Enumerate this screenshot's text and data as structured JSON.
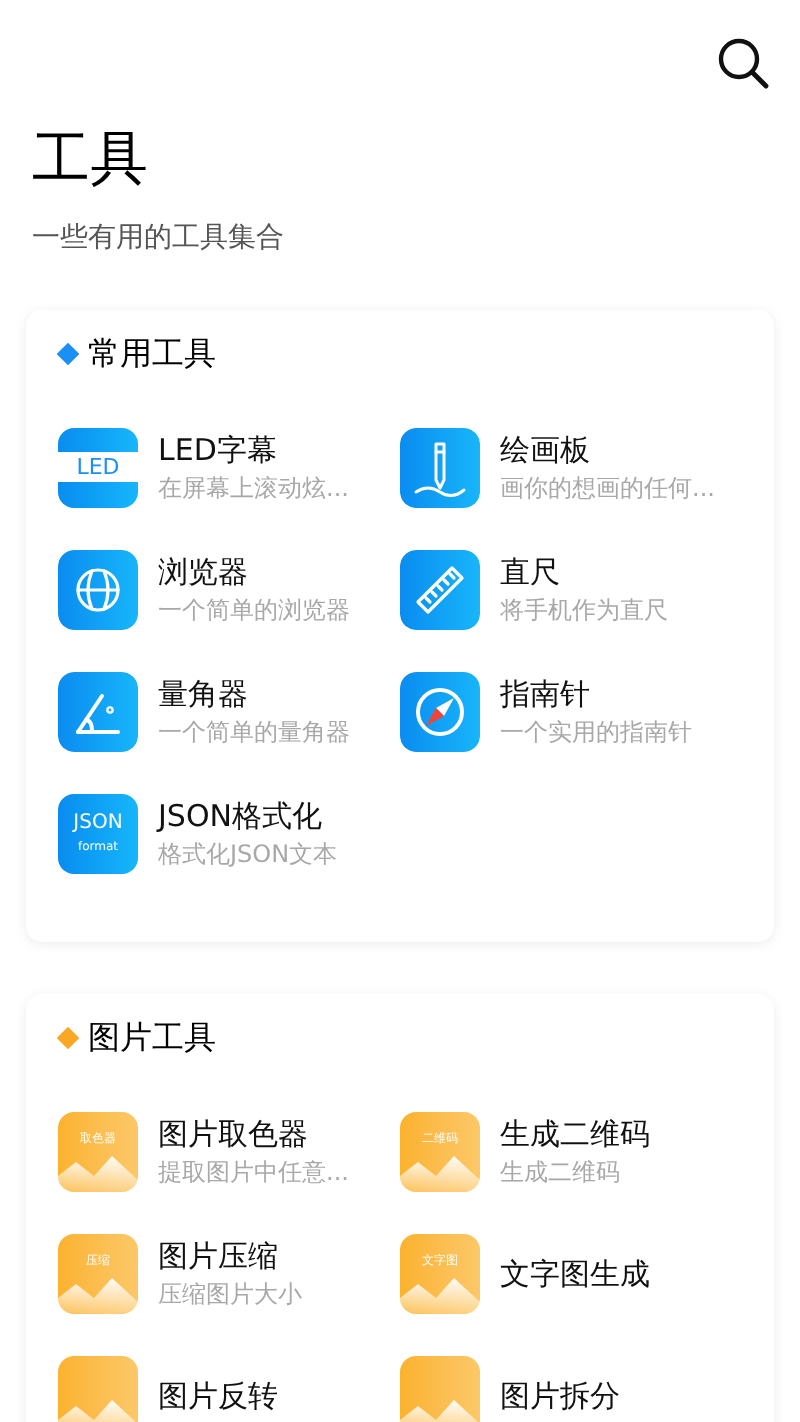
{
  "title": "工具",
  "subtitle": "一些有用的工具集合",
  "sections": [
    {
      "title": "常用工具",
      "color": "#1a8ff5",
      "items": [
        {
          "kind": "led",
          "icon_text": [
            "LED"
          ],
          "title": "LED字幕",
          "desc": "在屏幕上滚动炫..."
        },
        {
          "kind": "pen",
          "title": "绘画板",
          "desc": "画你的想画的任何..."
        },
        {
          "kind": "globe",
          "title": "浏览器",
          "desc": "一个简单的浏览器"
        },
        {
          "kind": "ruler",
          "title": "直尺",
          "desc": "将手机作为直尺"
        },
        {
          "kind": "protractor",
          "title": "量角器",
          "desc": "一个简单的量角器"
        },
        {
          "kind": "compass",
          "title": "指南针",
          "desc": "一个实用的指南针"
        },
        {
          "kind": "json",
          "icon_text": [
            "JSON",
            "format"
          ],
          "title": "JSON格式化",
          "desc": "格式化JSON文本"
        }
      ]
    },
    {
      "title": "图片工具",
      "color": "#f9a825",
      "items": [
        {
          "kind": "image",
          "icon_text": [
            "取色器"
          ],
          "title": "图片取色器",
          "desc": "提取图片中任意..."
        },
        {
          "kind": "image",
          "icon_text": [
            "二维码"
          ],
          "title": "生成二维码",
          "desc": "生成二维码"
        },
        {
          "kind": "image",
          "icon_text": [
            "压缩"
          ],
          "title": "图片压缩",
          "desc": "压缩图片大小"
        },
        {
          "kind": "image",
          "icon_text": [
            "文字图"
          ],
          "title": "文字图生成"
        },
        {
          "kind": "image",
          "title": "图片反转"
        },
        {
          "kind": "image",
          "title": "图片拆分"
        }
      ]
    }
  ]
}
